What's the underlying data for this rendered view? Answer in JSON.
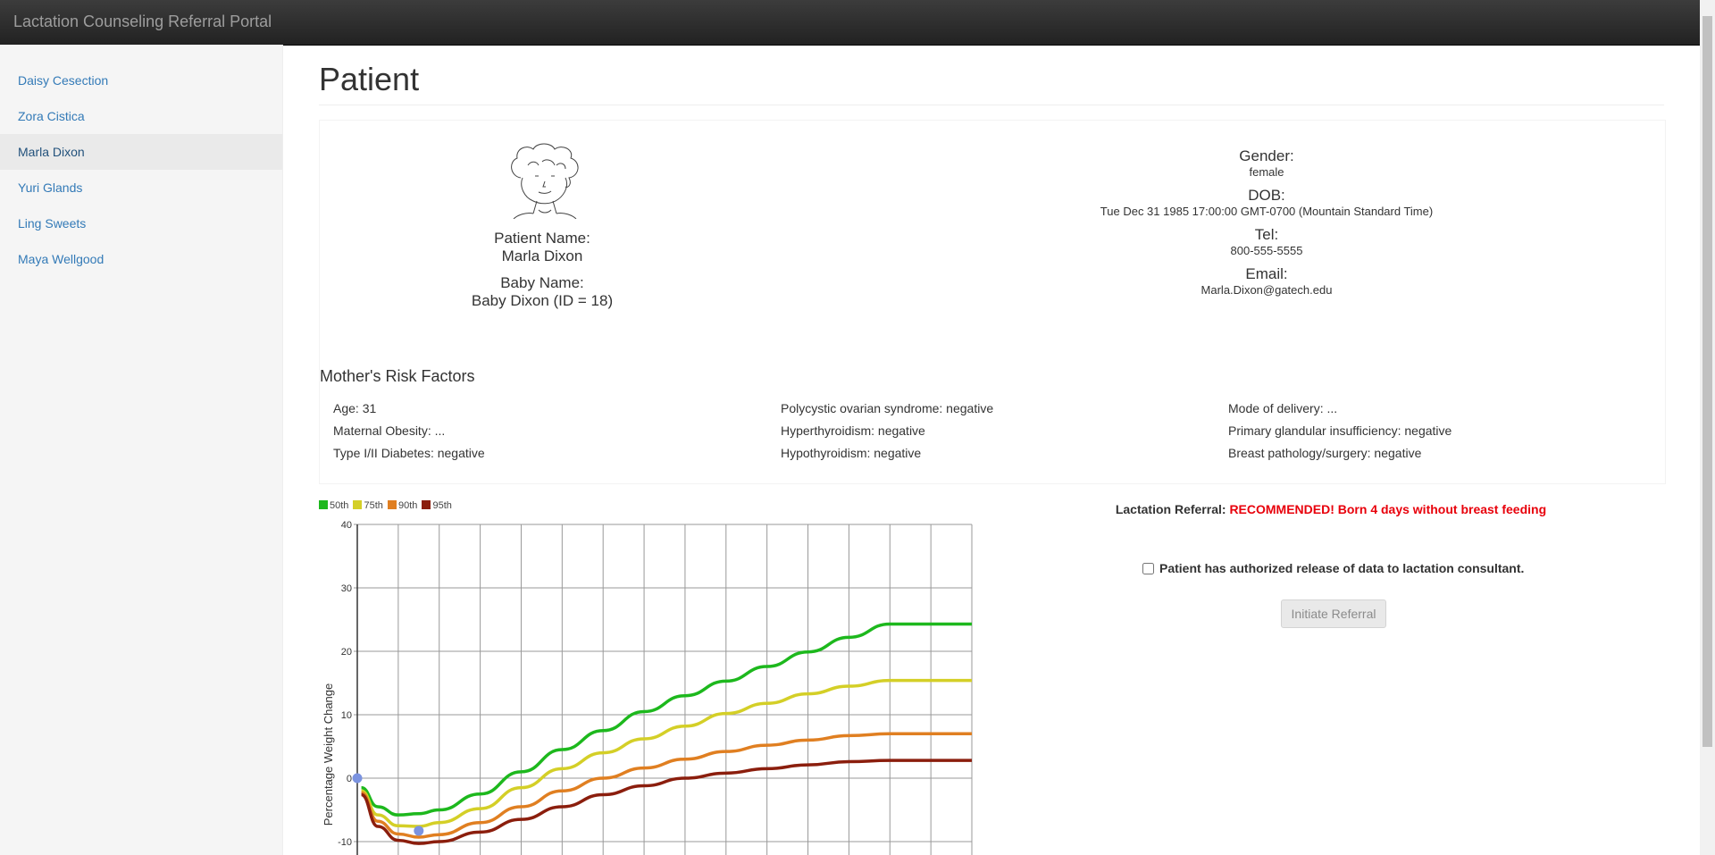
{
  "app": {
    "title": "Lactation Counseling Referral Portal"
  },
  "sidebar": {
    "items": [
      {
        "label": "Daisy Cesection"
      },
      {
        "label": "Zora Cistica"
      },
      {
        "label": "Marla Dixon"
      },
      {
        "label": "Yuri Glands"
      },
      {
        "label": "Ling Sweets"
      },
      {
        "label": "Maya Wellgood"
      }
    ]
  },
  "page": {
    "title": "Patient"
  },
  "patient": {
    "name_label": "Patient Name:",
    "name": "Marla Dixon",
    "baby_label": "Baby Name:",
    "baby": "Baby Dixon (ID = 18)",
    "gender_label": "Gender:",
    "gender": "female",
    "dob_label": "DOB:",
    "dob": "Tue Dec 31 1985 17:00:00 GMT-0700 (Mountain Standard Time)",
    "tel_label": "Tel:",
    "tel": "800-555-5555",
    "email_label": "Email:",
    "email": "Marla.Dixon@gatech.edu"
  },
  "risk": {
    "title": "Mother's Risk Factors",
    "col1": [
      "Age: 31",
      "Maternal Obesity: ...",
      "Type I/II Diabetes: negative"
    ],
    "col2": [
      "Polycystic ovarian syndrome: negative",
      "Hyperthyroidism: negative",
      "Hypothyroidism: negative"
    ],
    "col3": [
      "Mode of delivery: ...",
      "Primary glandular insufficiency: negative",
      "Breast pathology/surgery: negative"
    ]
  },
  "legend": [
    {
      "label": "50th",
      "color": "#1db81d"
    },
    {
      "label": "75th",
      "color": "#d4cf27"
    },
    {
      "label": "90th",
      "color": "#e07f21"
    },
    {
      "label": "95th",
      "color": "#8b1e0d"
    }
  ],
  "referral": {
    "label": "Lactation Referral:",
    "status": "RECOMMENDED! Born 4 days without breast feeding",
    "auth_text": "Patient has authorized release of data to lactation consultant.",
    "button": "Initiate Referral"
  },
  "chart_data": {
    "type": "line",
    "ylabel": "Percentage Weight Change",
    "xlabel": "",
    "ylim": [
      -10,
      40
    ],
    "yticks": [
      40,
      30,
      20,
      10,
      0,
      -10
    ],
    "x": [
      0.1,
      0.5,
      1,
      1.5,
      2,
      3,
      4,
      5,
      6,
      7,
      8,
      9,
      10,
      11,
      12,
      13,
      14,
      15
    ],
    "series": [
      {
        "name": "50th",
        "color": "#1db81d",
        "values": [
          -1.5,
          -4.5,
          -5.8,
          -5.6,
          -5.0,
          -2.5,
          1.0,
          4.5,
          7.5,
          10.5,
          13.0,
          15.3,
          17.6,
          19.9,
          22.2,
          24.3,
          24.3,
          24.3
        ]
      },
      {
        "name": "75th",
        "color": "#d4cf27",
        "values": [
          -2.0,
          -5.8,
          -7.5,
          -7.6,
          -7.0,
          -4.8,
          -1.5,
          1.5,
          4.0,
          6.2,
          8.2,
          10.2,
          11.8,
          13.3,
          14.5,
          15.4,
          15.4,
          15.4
        ]
      },
      {
        "name": "90th",
        "color": "#e07f21",
        "values": [
          -2.3,
          -6.8,
          -8.8,
          -9.3,
          -8.9,
          -7.0,
          -4.5,
          -2.0,
          0.0,
          1.6,
          3.0,
          4.2,
          5.2,
          6.0,
          6.7,
          7.0,
          7.0,
          7.0
        ]
      },
      {
        "name": "95th",
        "color": "#8b1e0d",
        "values": [
          -2.6,
          -7.6,
          -9.8,
          -10.3,
          -10.0,
          -8.5,
          -6.5,
          -4.5,
          -2.6,
          -1.2,
          0.0,
          0.8,
          1.5,
          2.1,
          2.6,
          2.8,
          2.8,
          2.8
        ]
      }
    ],
    "points": [
      {
        "x": 0,
        "y": 0
      },
      {
        "x": 1.5,
        "y": -8.3
      }
    ],
    "point_color": "#7b93e0"
  }
}
